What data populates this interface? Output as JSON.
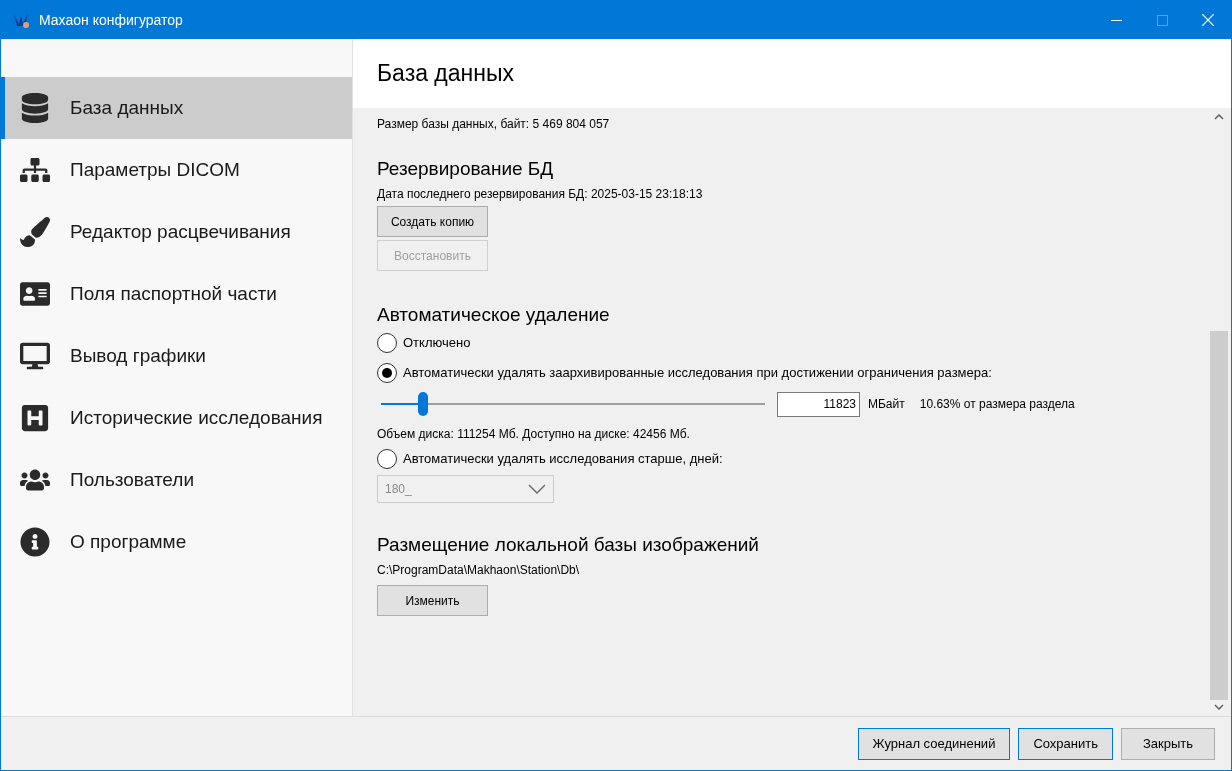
{
  "window": {
    "title": "Махаон конфигуратор",
    "maximize_disabled": true
  },
  "sidebar": {
    "items": [
      {
        "label": "База данных",
        "selected": true
      },
      {
        "label": "Параметры DICOM",
        "selected": false
      },
      {
        "label": "Редактор расцвечивания",
        "selected": false
      },
      {
        "label": "Поля паспортной части",
        "selected": false
      },
      {
        "label": "Вывод графики",
        "selected": false
      },
      {
        "label": "Исторические исследования",
        "selected": false
      },
      {
        "label": "Пользователи",
        "selected": false
      },
      {
        "label": "О программе",
        "selected": false
      }
    ]
  },
  "page": {
    "title": "База данных",
    "db_size_label": "Размер базы данных, байт:",
    "db_size": "5 469 804 057"
  },
  "backup": {
    "title": "Резервирование БД",
    "last_label": "Дата последнего резервирования БД:",
    "last_value": "2025-03-15 23:18:13",
    "buttons": [
      {
        "label": "Создать копию",
        "disabled": false
      },
      {
        "label": "Восстановить",
        "disabled": true
      }
    ]
  },
  "auto_delete": {
    "title": "Автоматическое удаление",
    "options": [
      {
        "label": "Отключено",
        "selected": false
      },
      {
        "label": "Автоматически удалять заархивированные исследования при достижении ограничения размера:",
        "selected": true
      },
      {
        "label": "Автоматически удалять исследования старше, дней:",
        "selected": false
      }
    ],
    "slider": {
      "level": 0.11
    },
    "size_value": "11823",
    "size_unit": "МБайт",
    "size_percent": "10.63% от размера раздела",
    "disk_info": "Объем диска: 111254 Мб. Доступно на диске: 42456 Мб.",
    "days": {
      "value": "180_",
      "disabled": true
    }
  },
  "storage": {
    "title": "Размещение локальной базы изображений",
    "path": "C:\\ProgramData\\Makhaon\\Station\\Db\\",
    "button": "Изменить"
  },
  "footer": {
    "buttons": [
      {
        "label": "Журнал соединений",
        "highlighted": true
      },
      {
        "label": "Сохранить",
        "highlighted": true
      },
      {
        "label": "Закрыть",
        "highlighted": false
      }
    ]
  }
}
